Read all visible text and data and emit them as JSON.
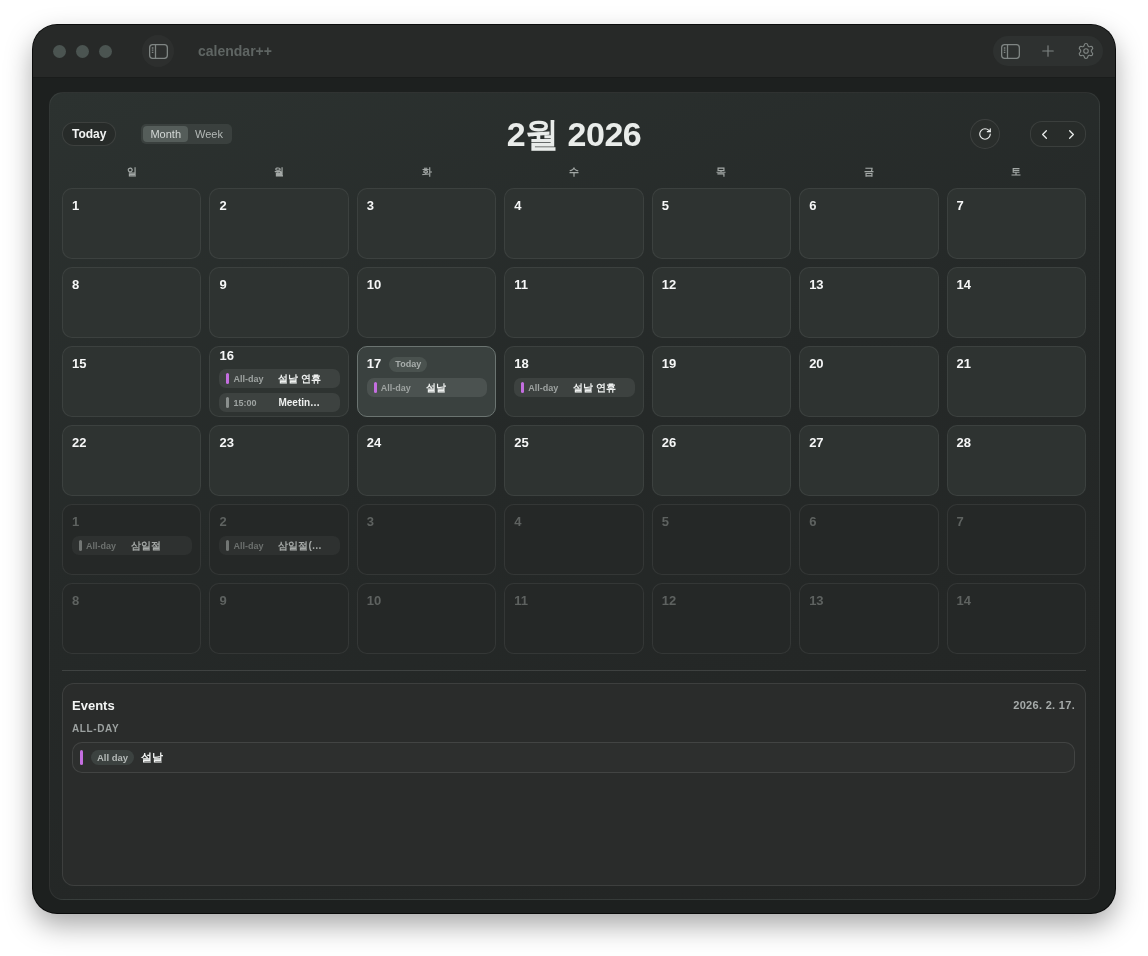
{
  "window": {
    "title": "calendar++"
  },
  "header": {
    "today_button": "Today",
    "view_tabs": [
      {
        "label": "Month",
        "selected": true
      },
      {
        "label": "Week",
        "selected": false
      }
    ],
    "title": "2월 2026"
  },
  "weekdays": [
    "일",
    "월",
    "화",
    "수",
    "목",
    "금",
    "토"
  ],
  "weeks": [
    [
      {
        "day": "1",
        "outside": false,
        "selected": false
      },
      {
        "day": "2",
        "outside": false,
        "selected": false
      },
      {
        "day": "3",
        "outside": false,
        "selected": false
      },
      {
        "day": "4",
        "outside": false,
        "selected": false
      },
      {
        "day": "5",
        "outside": false,
        "selected": false
      },
      {
        "day": "6",
        "outside": false,
        "selected": false
      },
      {
        "day": "7",
        "outside": false,
        "selected": false
      }
    ],
    [
      {
        "day": "8",
        "outside": false,
        "selected": false
      },
      {
        "day": "9",
        "outside": false,
        "selected": false
      },
      {
        "day": "10",
        "outside": false,
        "selected": false
      },
      {
        "day": "11",
        "outside": false,
        "selected": false
      },
      {
        "day": "12",
        "outside": false,
        "selected": false
      },
      {
        "day": "13",
        "outside": false,
        "selected": false
      },
      {
        "day": "14",
        "outside": false,
        "selected": false
      }
    ],
    [
      {
        "day": "15",
        "outside": false,
        "selected": false
      },
      {
        "day": "16",
        "outside": false,
        "selected": false,
        "events": [
          {
            "time": "All-day",
            "title": "설날 연휴",
            "color": "#c46ee0"
          },
          {
            "time": "15:00",
            "title": "Meetin…",
            "color": "#8a8f8d"
          }
        ]
      },
      {
        "day": "17",
        "outside": false,
        "selected": true,
        "badge": "Today",
        "events": [
          {
            "time": "All-day",
            "title": "설날",
            "color": "#c46ee0"
          }
        ]
      },
      {
        "day": "18",
        "outside": false,
        "selected": false,
        "events": [
          {
            "time": "All-day",
            "title": "설날 연휴",
            "color": "#c46ee0"
          }
        ]
      },
      {
        "day": "19",
        "outside": false,
        "selected": false
      },
      {
        "day": "20",
        "outside": false,
        "selected": false
      },
      {
        "day": "21",
        "outside": false,
        "selected": false
      }
    ],
    [
      {
        "day": "22",
        "outside": false,
        "selected": false
      },
      {
        "day": "23",
        "outside": false,
        "selected": false
      },
      {
        "day": "24",
        "outside": false,
        "selected": false
      },
      {
        "day": "25",
        "outside": false,
        "selected": false
      },
      {
        "day": "26",
        "outside": false,
        "selected": false
      },
      {
        "day": "27",
        "outside": false,
        "selected": false
      },
      {
        "day": "28",
        "outside": false,
        "selected": false
      }
    ],
    [
      {
        "day": "1",
        "outside": true,
        "selected": false,
        "events": [
          {
            "time": "All-day",
            "title": "삼일절",
            "color": "#727674"
          }
        ]
      },
      {
        "day": "2",
        "outside": true,
        "selected": false,
        "events": [
          {
            "time": "All-day",
            "title": "삼일절(…",
            "color": "#727674"
          }
        ]
      },
      {
        "day": "3",
        "outside": true,
        "selected": false
      },
      {
        "day": "4",
        "outside": true,
        "selected": false
      },
      {
        "day": "5",
        "outside": true,
        "selected": false
      },
      {
        "day": "6",
        "outside": true,
        "selected": false
      },
      {
        "day": "7",
        "outside": true,
        "selected": false
      }
    ],
    [
      {
        "day": "8",
        "outside": true,
        "selected": false
      },
      {
        "day": "9",
        "outside": true,
        "selected": false
      },
      {
        "day": "10",
        "outside": true,
        "selected": false
      },
      {
        "day": "11",
        "outside": true,
        "selected": false
      },
      {
        "day": "12",
        "outside": true,
        "selected": false
      },
      {
        "day": "13",
        "outside": true,
        "selected": false
      },
      {
        "day": "14",
        "outside": true,
        "selected": false
      }
    ]
  ],
  "events_panel": {
    "title": "Events",
    "date": "2026. 2. 17.",
    "sections": [
      {
        "heading": "ALL-DAY",
        "items": [
          {
            "badge": "All day",
            "title": "설날",
            "color": "#c46ee0"
          }
        ]
      }
    ]
  }
}
